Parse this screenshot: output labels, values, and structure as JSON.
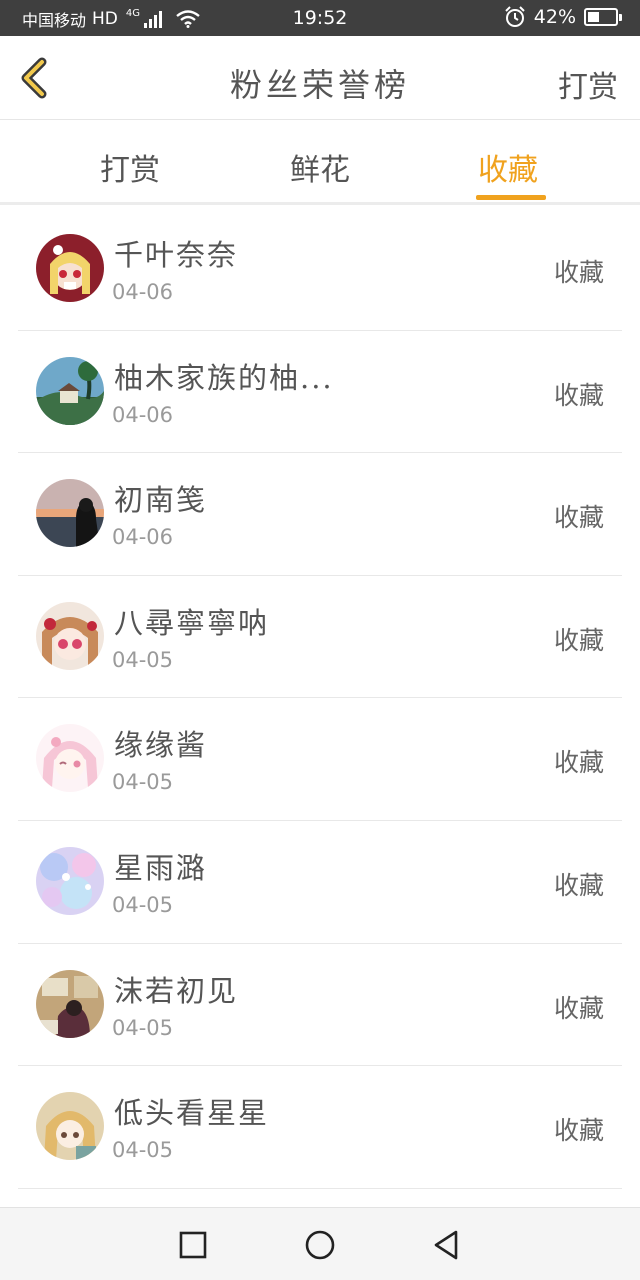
{
  "status_bar": {
    "carrier": "中国移动",
    "hd": "HD",
    "network": "4G",
    "time": "19:52",
    "battery_text": "42%",
    "battery_level": 0.42
  },
  "header": {
    "title": "粉丝荣誉榜",
    "action_label": "打赏"
  },
  "tabs": [
    {
      "label": "打赏"
    },
    {
      "label": "鲜花"
    },
    {
      "label": "收藏"
    }
  ],
  "active_tab": 2,
  "list": [
    {
      "name": "千叶奈奈",
      "date": "04-06",
      "action": "收藏"
    },
    {
      "name": "柚木家族的柚...",
      "date": "04-06",
      "action": "收藏"
    },
    {
      "name": "初南笺",
      "date": "04-06",
      "action": "收藏"
    },
    {
      "name": "八尋寧寧呐",
      "date": "04-05",
      "action": "收藏"
    },
    {
      "name": "缘缘酱",
      "date": "04-05",
      "action": "收藏"
    },
    {
      "name": "星雨潞",
      "date": "04-05",
      "action": "收藏"
    },
    {
      "name": "沫若初见",
      "date": "04-05",
      "action": "收藏"
    },
    {
      "name": "低头看星星",
      "date": "04-05",
      "action": "收藏"
    }
  ],
  "colors": {
    "accent": "#f0a21e",
    "status_bar_bg": "#3f3f3f"
  }
}
